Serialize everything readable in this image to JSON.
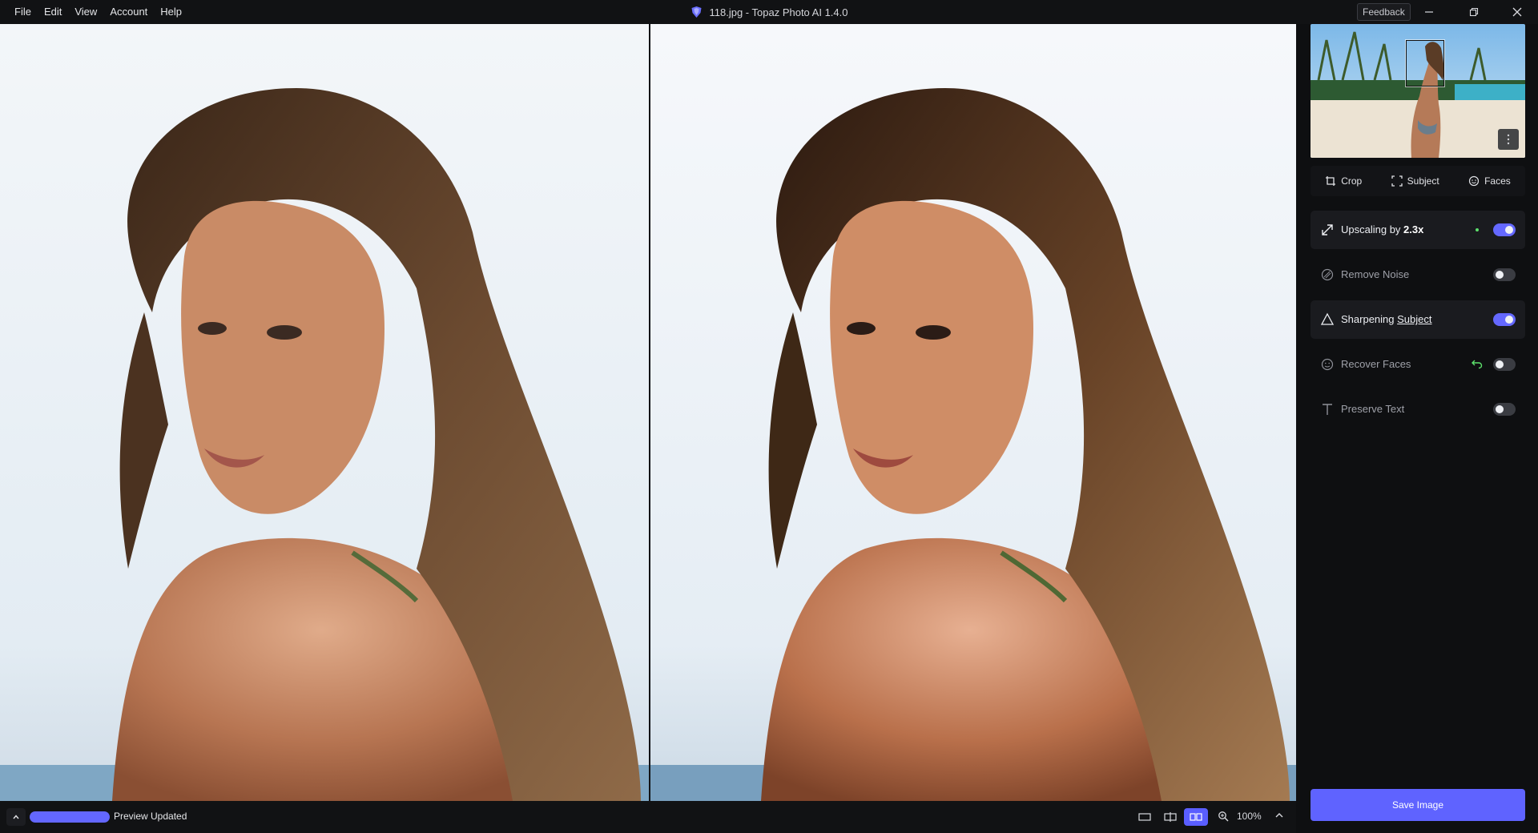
{
  "menu": [
    "File",
    "Edit",
    "View",
    "Account",
    "Help"
  ],
  "window": {
    "title": "118.jpg - Topaz Photo AI 1.4.0",
    "feedback_label": "Feedback"
  },
  "bottom": {
    "status": "Preview Updated",
    "zoom": "100%",
    "progress": 1.0
  },
  "tools": {
    "crop": "Crop",
    "subject": "Subject",
    "faces": "Faces"
  },
  "features": {
    "upscaling": {
      "label": "Upscaling by ",
      "value": "2.3x",
      "enabled": true
    },
    "remove_noise": {
      "label": "Remove Noise",
      "enabled": false
    },
    "sharpening": {
      "label": "Sharpening",
      "link": "Subject",
      "enabled": true
    },
    "recover_faces": {
      "label": "Recover Faces",
      "enabled": false
    },
    "preserve_text": {
      "label": "Preserve Text",
      "enabled": false
    }
  },
  "save_label": "Save Image",
  "colors": {
    "accent": "#5f63ff",
    "status_dot": "#5de06c"
  }
}
